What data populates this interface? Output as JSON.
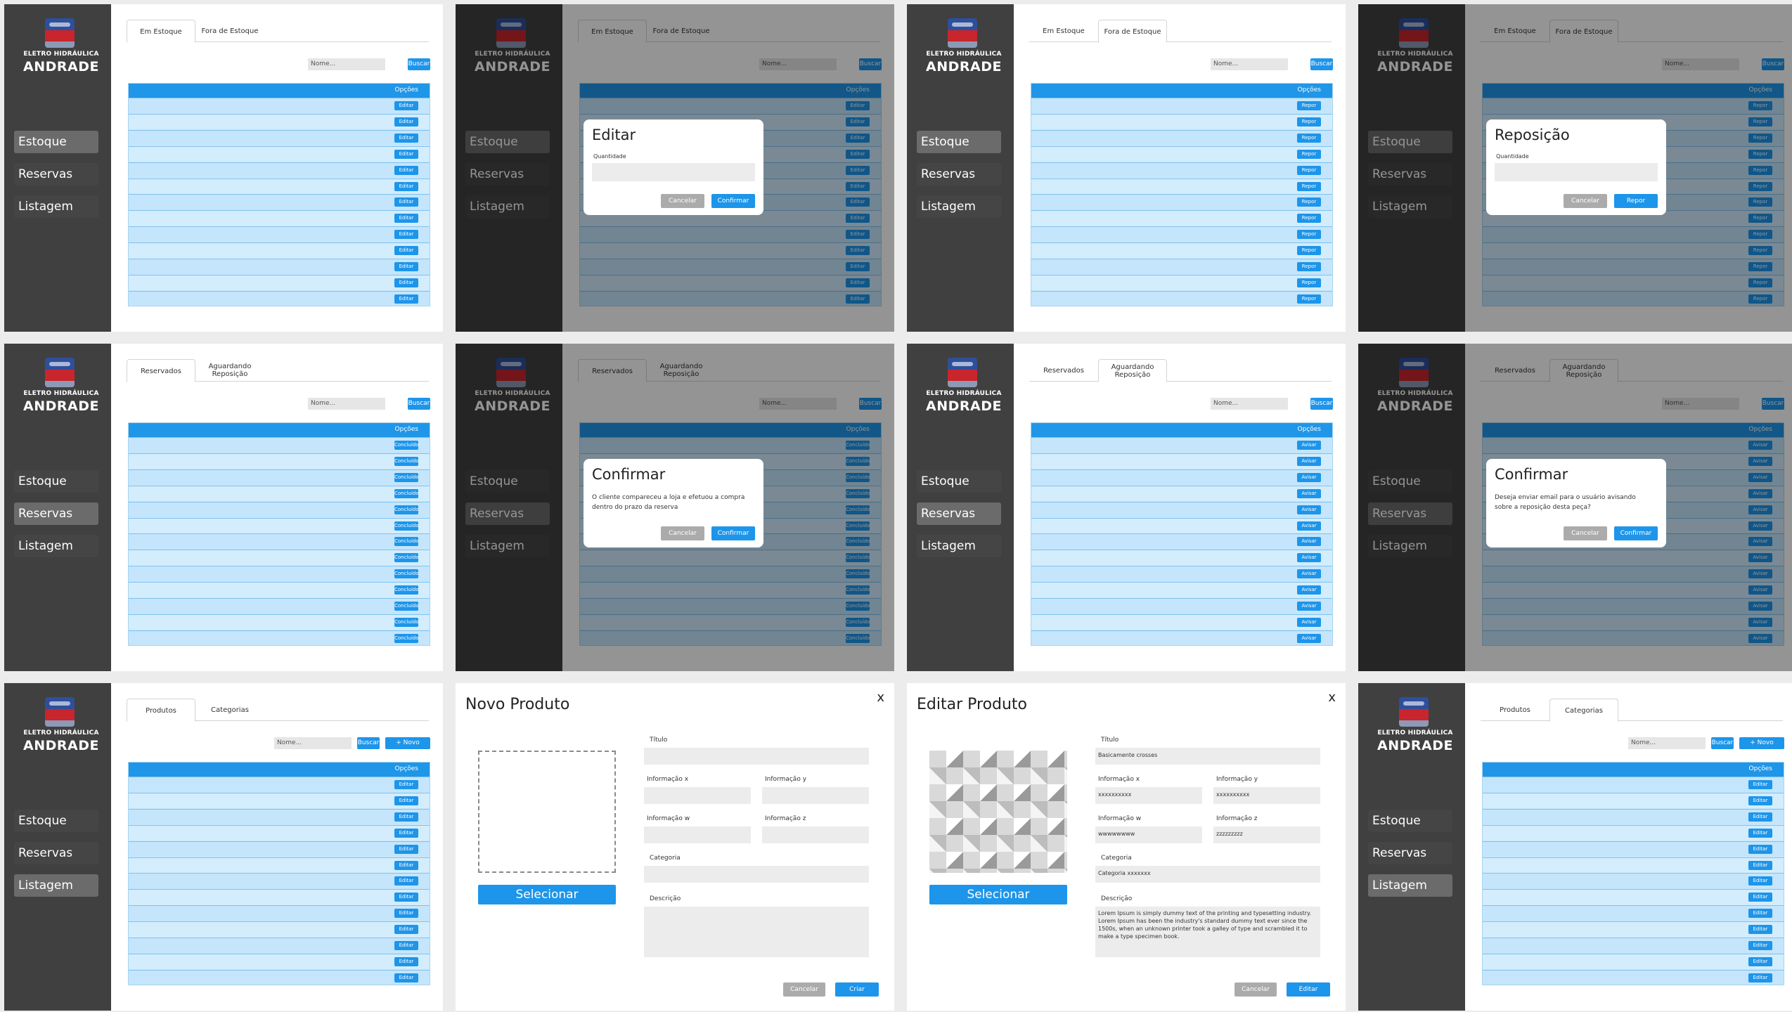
{
  "brand": {
    "top": "ELETRO HIDRÁULICA",
    "name": "ANDRADE"
  },
  "nav": {
    "estoque": "Estoque",
    "reservas": "Reservas",
    "listagem": "Listagem"
  },
  "tabs": {
    "em_estoque": "Em Estoque",
    "fora_estoque": "Fora de Estoque",
    "reservados": "Reservados",
    "aguardando_1": "Aguardando",
    "aguardando_2": "Reposição",
    "produtos": "Produtos",
    "categorias": "Categorias"
  },
  "search": {
    "placeholder": "Nome...",
    "button": "Buscar",
    "add_button": "+ Novo"
  },
  "table": {
    "header": "Opções"
  },
  "row_buttons": {
    "editar": "Editar",
    "repor": "Repor",
    "concluido": "Concluído",
    "avisar": "Avisar"
  },
  "modals": {
    "editar": {
      "title": "Editar",
      "label": "Quantidade",
      "cancel": "Cancelar",
      "confirm": "Confirmar"
    },
    "reposicao": {
      "title": "Reposição",
      "label": "Quantidade",
      "cancel": "Cancelar",
      "confirm": "Repor"
    },
    "confirmar_reserva": {
      "title": "Confirmar",
      "text": "O cliente compareceu a loja e efetuou a compra dentro do prazo da reserva",
      "cancel": "Cancelar",
      "confirm": "Confirmar"
    },
    "confirmar_aviso": {
      "title": "Confirmar",
      "text": "Deseja enviar email para o usuário avisando sobre a reposição desta peça?",
      "cancel": "Cancelar",
      "confirm": "Confirmar"
    }
  },
  "novo_produto": {
    "title": "Novo Produto",
    "close": "x",
    "select_button": "Selecionar",
    "labels": {
      "titulo": "Título",
      "info_x": "Informação x",
      "info_y": "Informação y",
      "info_w": "Informação w",
      "info_z": "Informação z",
      "categoria": "Categoria",
      "descricao": "Descrição"
    },
    "cancel": "Cancelar",
    "create": "Criar"
  },
  "editar_produto": {
    "title": "Editar Produto",
    "close": "x",
    "select_button": "Selecionar",
    "values": {
      "titulo": "Basicamente crosses",
      "info_x": "xxxxxxxxxx",
      "info_y": "xxxxxxxxxx",
      "info_w": "wwwwwwww",
      "info_z": "zzzzzzzzz",
      "categoria": "Categoria xxxxxxx",
      "descricao": "Lorem Ipsum is simply dummy text of the printing and typesetting industry. Lorem Ipsum has been the industry's standard dummy text ever since the 1500s, when an unknown printer took a galley of type and scrambled it to make a type specimen book."
    },
    "cancel": "Cancelar",
    "save": "Editar"
  },
  "colors": {
    "sidebar": "#404040",
    "accent": "#1d95ea",
    "row": "#c4e5fb"
  }
}
